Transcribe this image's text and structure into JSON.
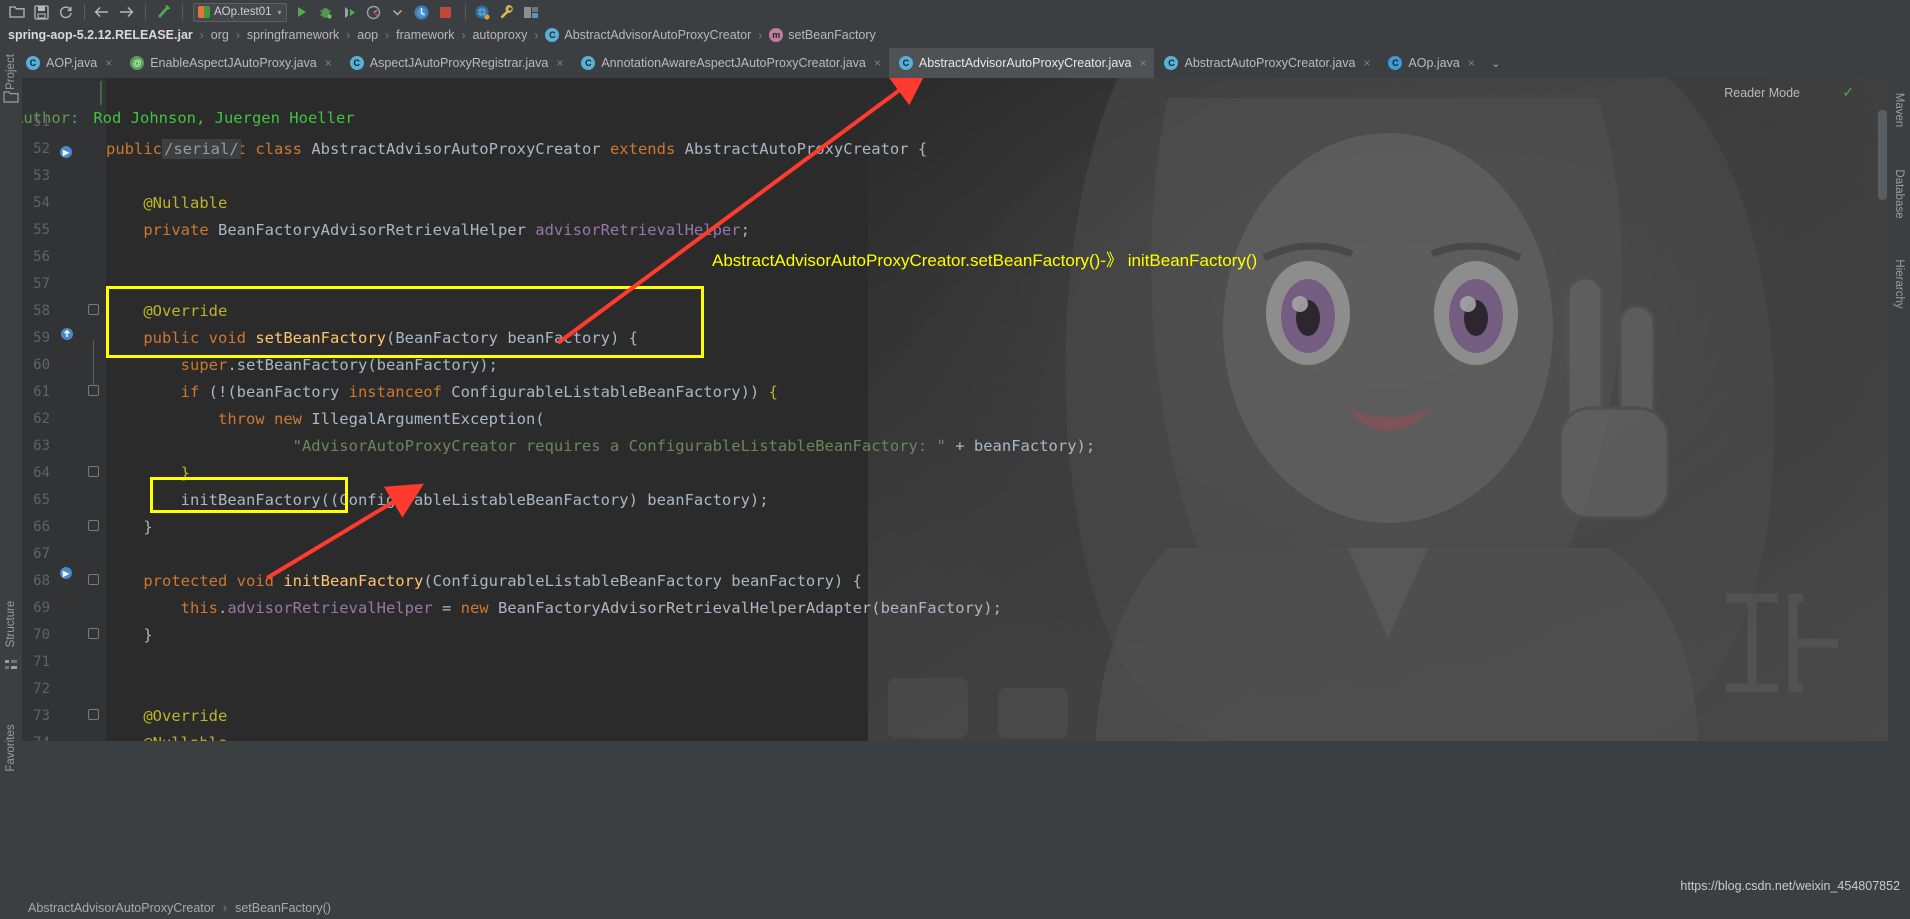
{
  "toolbar": {
    "icons": [
      "open-folder-icon",
      "save-icon",
      "sync-icon",
      "back-arrow-icon",
      "forward-arrow-icon",
      "build-hammer-icon"
    ],
    "run_config": {
      "label": "AOp.test01",
      "arrow": "▾"
    },
    "run_icons": [
      "run-icon",
      "debug-icon",
      "run-with-coverage-icon",
      "profiler-icon",
      "profiler-dropdown-icon",
      "inspect-icon",
      "stop-icon",
      "search-everywhere-icon",
      "settings-wrench-icon",
      "project-structure-icon"
    ]
  },
  "breadcrumb": {
    "items": [
      {
        "label": "spring-aop-5.2.12.RELEASE.jar",
        "type": "jar"
      },
      {
        "label": "org",
        "type": "pkg"
      },
      {
        "label": "springframework",
        "type": "pkg"
      },
      {
        "label": "aop",
        "type": "pkg"
      },
      {
        "label": "framework",
        "type": "pkg"
      },
      {
        "label": "autoproxy",
        "type": "pkg"
      },
      {
        "label": "AbstractAdvisorAutoProxyCreator",
        "type": "class",
        "badge": "C"
      },
      {
        "label": "setBeanFactory",
        "type": "method",
        "badge": "m"
      }
    ],
    "separator": "›"
  },
  "tabs": [
    {
      "label": "AOP.java",
      "icon": "class-icon",
      "icon_kind": "blue",
      "active": false,
      "clipped": true
    },
    {
      "label": "EnableAspectJAutoProxy.java",
      "icon": "annotation-icon",
      "icon_kind": "green",
      "active": false
    },
    {
      "label": "AspectJAutoProxyRegistrar.java",
      "icon": "class-icon",
      "icon_kind": "blue",
      "active": false
    },
    {
      "label": "AnnotationAwareAspectJAutoProxyCreator.java",
      "icon": "class-icon",
      "icon_kind": "blue",
      "active": false
    },
    {
      "label": "AbstractAdvisorAutoProxyCreator.java",
      "icon": "class-icon",
      "icon_kind": "blue",
      "active": true
    },
    {
      "label": "AbstractAutoProxyCreator.java",
      "icon": "class-icon",
      "icon_kind": "blue",
      "active": false
    },
    {
      "label": "AOp.java",
      "icon": "java-file-icon",
      "icon_kind": "ide",
      "active": false
    }
  ],
  "tab_close_glyph": "×",
  "tab_overflow_glyph": "⌄",
  "editor": {
    "reader_mode": "Reader Mode",
    "reader_check": "✓",
    "javadoc_author_label": "Author:",
    "javadoc_author_value": "Rod Johnson, Juergen Hoeller",
    "serial_fold": "/serial/",
    "lines": [
      {
        "num": "51",
        "tokens": []
      },
      {
        "num": "52",
        "tokens": [
          {
            "t": "public ",
            "c": "kw"
          },
          {
            "t": "abstract ",
            "c": "kw"
          },
          {
            "t": "class ",
            "c": "kw"
          },
          {
            "t": "AbstractAdvisorAutoProxyCreator ",
            "c": "cls"
          },
          {
            "t": "extends ",
            "c": "kw"
          },
          {
            "t": "AbstractAutoProxyCreator {",
            "c": "cls"
          }
        ]
      },
      {
        "num": "53",
        "tokens": []
      },
      {
        "num": "54",
        "tokens": [
          {
            "t": "    @Nullable",
            "c": "ann"
          }
        ]
      },
      {
        "num": "55",
        "tokens": [
          {
            "t": "    ",
            "c": "pln"
          },
          {
            "t": "private ",
            "c": "kw"
          },
          {
            "t": "BeanFactoryAdvisorRetrievalHelper ",
            "c": "cls"
          },
          {
            "t": "advisorRetrievalHelper",
            "c": "fld"
          },
          {
            "t": ";",
            "c": "pln"
          }
        ]
      },
      {
        "num": "56",
        "tokens": []
      },
      {
        "num": "57",
        "tokens": []
      },
      {
        "num": "58",
        "tokens": [
          {
            "t": "    @Override",
            "c": "ann"
          }
        ]
      },
      {
        "num": "59",
        "tokens": [
          {
            "t": "    ",
            "c": "pln"
          },
          {
            "t": "public ",
            "c": "kw"
          },
          {
            "t": "void ",
            "c": "kw"
          },
          {
            "t": "setBeanFactory",
            "c": "mth"
          },
          {
            "t": "(",
            "c": "pln"
          },
          {
            "t": "BeanFactory ",
            "c": "cls"
          },
          {
            "t": "beanFactory",
            "c": "pln"
          },
          {
            "t": ") {",
            "c": "pln"
          }
        ]
      },
      {
        "num": "60",
        "tokens": [
          {
            "t": "        ",
            "c": "pln"
          },
          {
            "t": "super",
            "c": "kw"
          },
          {
            "t": ".",
            "c": "pln"
          },
          {
            "t": "setBeanFactory",
            "c": "pln"
          },
          {
            "t": "(beanFactory);",
            "c": "pln"
          }
        ]
      },
      {
        "num": "61",
        "tokens": [
          {
            "t": "        ",
            "c": "pln"
          },
          {
            "t": "if ",
            "c": "kw"
          },
          {
            "t": "(!(beanFactory ",
            "c": "pln"
          },
          {
            "t": "instanceof ",
            "c": "kw"
          },
          {
            "t": "ConfigurableListableBeanFactory)) ",
            "c": "cls"
          },
          {
            "t": "{",
            "c": "ann"
          }
        ]
      },
      {
        "num": "62",
        "tokens": [
          {
            "t": "            ",
            "c": "pln"
          },
          {
            "t": "throw ",
            "c": "kw"
          },
          {
            "t": "new ",
            "c": "kw"
          },
          {
            "t": "IllegalArgumentException",
            "c": "cls"
          },
          {
            "t": "(",
            "c": "pln"
          }
        ]
      },
      {
        "num": "63",
        "tokens": [
          {
            "t": "                    ",
            "c": "pln"
          },
          {
            "t": "\"AdvisorAutoProxyCreator requires a ConfigurableListableBeanFactory: \"",
            "c": "str"
          },
          {
            "t": " + beanFactory);",
            "c": "pln"
          }
        ]
      },
      {
        "num": "64",
        "tokens": [
          {
            "t": "        }",
            "c": "ann"
          }
        ]
      },
      {
        "num": "65",
        "tokens": [
          {
            "t": "        ",
            "c": "pln"
          },
          {
            "t": "initBeanFactory",
            "c": "pln"
          },
          {
            "t": "((ConfigurableListableBeanFactory) beanFactory);",
            "c": "pln"
          }
        ]
      },
      {
        "num": "66",
        "tokens": [
          {
            "t": "    }",
            "c": "pln"
          }
        ]
      },
      {
        "num": "67",
        "tokens": []
      },
      {
        "num": "68",
        "tokens": [
          {
            "t": "    ",
            "c": "pln"
          },
          {
            "t": "protected ",
            "c": "kw"
          },
          {
            "t": "void ",
            "c": "kw"
          },
          {
            "t": "initBeanFactory",
            "c": "mth"
          },
          {
            "t": "(",
            "c": "pln"
          },
          {
            "t": "ConfigurableListableBeanFactory ",
            "c": "cls"
          },
          {
            "t": "beanFactory",
            "c": "pln"
          },
          {
            "t": ") {",
            "c": "pln"
          }
        ]
      },
      {
        "num": "69",
        "tokens": [
          {
            "t": "        ",
            "c": "pln"
          },
          {
            "t": "this",
            "c": "kw"
          },
          {
            "t": ".",
            "c": "pln"
          },
          {
            "t": "advisorRetrievalHelper",
            "c": "fld"
          },
          {
            "t": " = ",
            "c": "pln"
          },
          {
            "t": "new ",
            "c": "kw"
          },
          {
            "t": "BeanFactoryAdvisorRetrievalHelperAdapter",
            "c": "cls"
          },
          {
            "t": "(beanFactory);",
            "c": "pln"
          }
        ]
      },
      {
        "num": "70",
        "tokens": [
          {
            "t": "    }",
            "c": "pln"
          }
        ]
      },
      {
        "num": "71",
        "tokens": []
      },
      {
        "num": "72",
        "tokens": []
      },
      {
        "num": "73",
        "tokens": [
          {
            "t": "    @Override",
            "c": "ann"
          }
        ]
      },
      {
        "num": "74",
        "tokens": [
          {
            "t": "    @Nullable",
            "c": "ann"
          }
        ]
      }
    ]
  },
  "annotations": {
    "note_text": "AbstractAdvisorAutoProxyCreator.setBeanFactory()-》 initBeanFactory()",
    "highlight_color": "#ffff00",
    "arrow_color": "#ff3b30"
  },
  "right_panel": {
    "items": [
      "Maven",
      "Database",
      "Hierarchy"
    ]
  },
  "left_panel": {
    "items": [
      "Project",
      "Structure",
      "Favorites"
    ]
  },
  "status_bar": {
    "breadcrumb": [
      "AbstractAdvisorAutoProxyCreator",
      "setBeanFactory()"
    ],
    "separator": "›"
  },
  "watermark": "https://blog.csdn.net/weixin_454807852"
}
